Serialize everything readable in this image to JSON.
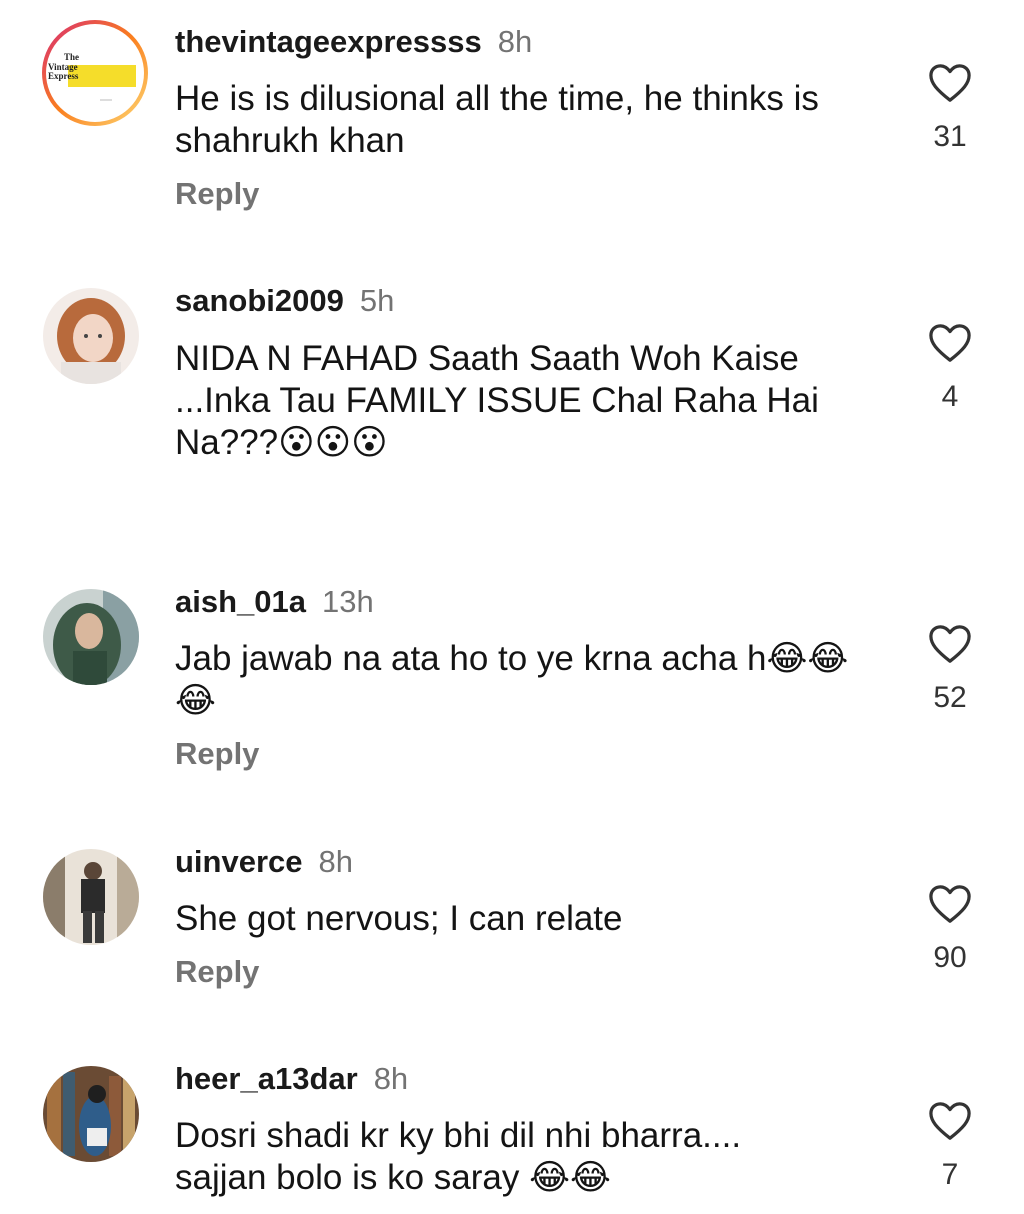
{
  "comments": [
    {
      "username": "thevintageexpressss",
      "time": "8h",
      "text": "He is is dilusional all the time, he thinks is shahrukh khan",
      "reply_label": "Reply",
      "likes": "31",
      "avatar_logo": {
        "line1": "The",
        "line2": "Vintage",
        "line3": "Express"
      }
    },
    {
      "username": "sanobi2009",
      "time": "5h",
      "text": "NIDA N FAHAD Saath Saath Woh Kaise ...Inka Tau FAMILY ISSUE Chal Raha Hai Na???😮😮😮",
      "likes": "4"
    },
    {
      "username": "aish_01a",
      "time": "13h",
      "text": "Jab jawab na ata ho to ye krna acha h😂😂😂",
      "reply_label": "Reply",
      "likes": "52"
    },
    {
      "username": "uinverce",
      "time": "8h",
      "text": "She got nervous; I can relate",
      "reply_label": "Reply",
      "likes": "90"
    },
    {
      "username": "heer_a13dar",
      "time": "8h",
      "text": "Dosri shadi kr ky bhi dil nhi bharra.... sajjan bolo is ko saray 😂😂",
      "likes": "7"
    }
  ],
  "icons": {
    "like": "heart-outline-icon"
  },
  "colors": {
    "secondary_text": "#737373",
    "story_ring": "#e1306c"
  }
}
